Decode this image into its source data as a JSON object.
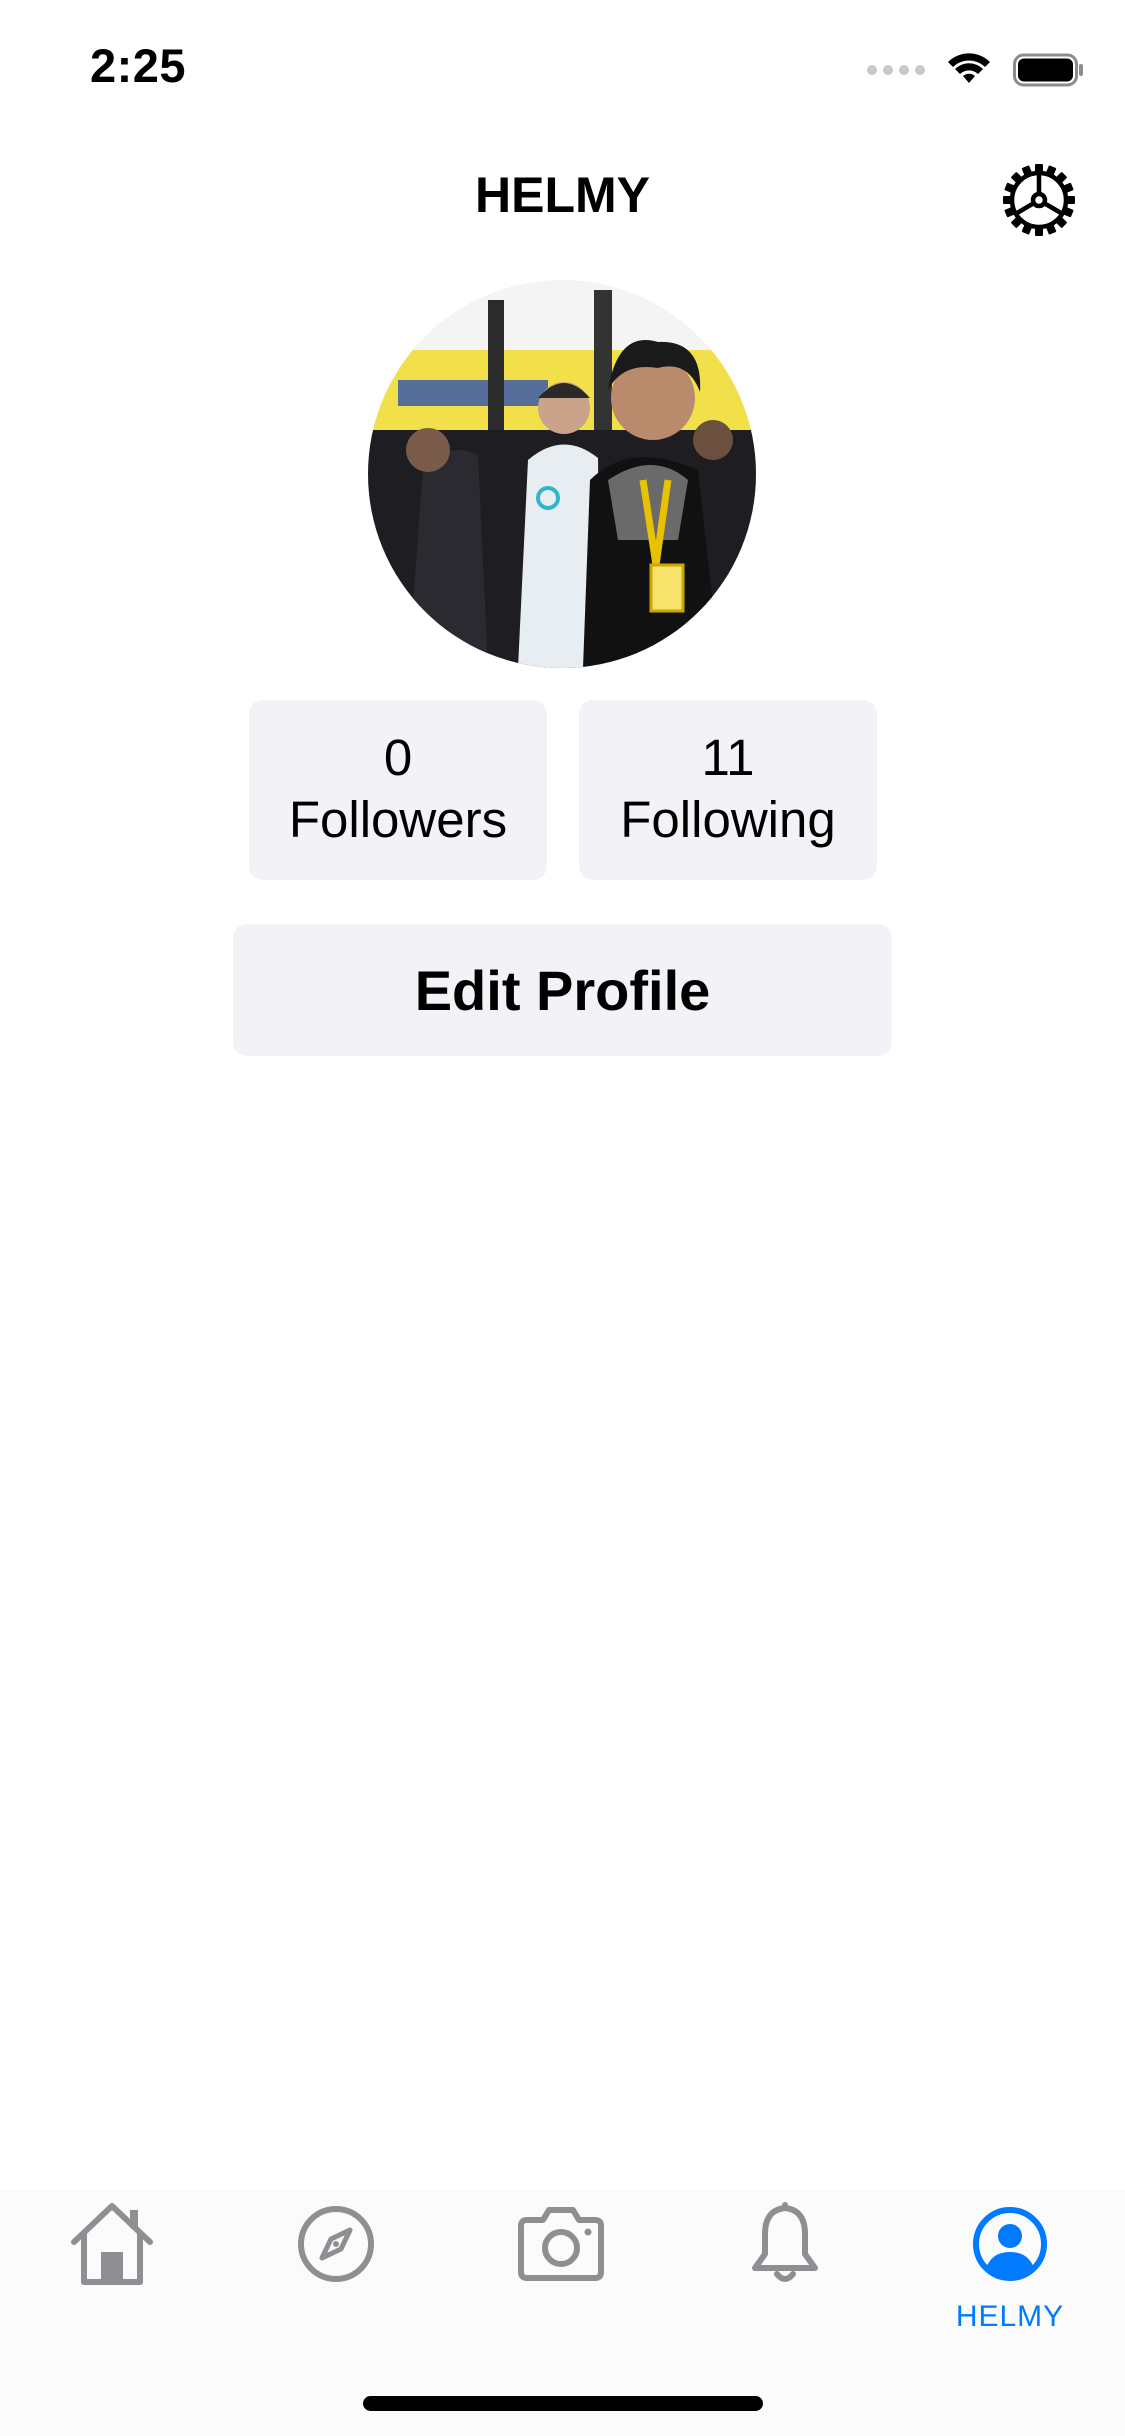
{
  "status_bar": {
    "time": "2:25"
  },
  "header": {
    "title": "HELMY",
    "settings_icon": "gear-icon"
  },
  "profile": {
    "avatar": "profile-photo",
    "stats": {
      "followers_count": "0",
      "followers_label": "Followers",
      "following_count": "11",
      "following_label": "Following"
    },
    "edit_button_label": "Edit Profile"
  },
  "tab_bar": {
    "items": [
      {
        "icon": "home-icon",
        "label": ""
      },
      {
        "icon": "compass-icon",
        "label": ""
      },
      {
        "icon": "camera-icon",
        "label": ""
      },
      {
        "icon": "bell-icon",
        "label": ""
      },
      {
        "icon": "profile-icon",
        "label": "HELMY"
      }
    ],
    "active_color": "#007aff",
    "inactive_color": "#8e8e93"
  },
  "colors": {
    "background": "#ffffff",
    "button_background": "#f2f2f7",
    "accent": "#007aff"
  }
}
